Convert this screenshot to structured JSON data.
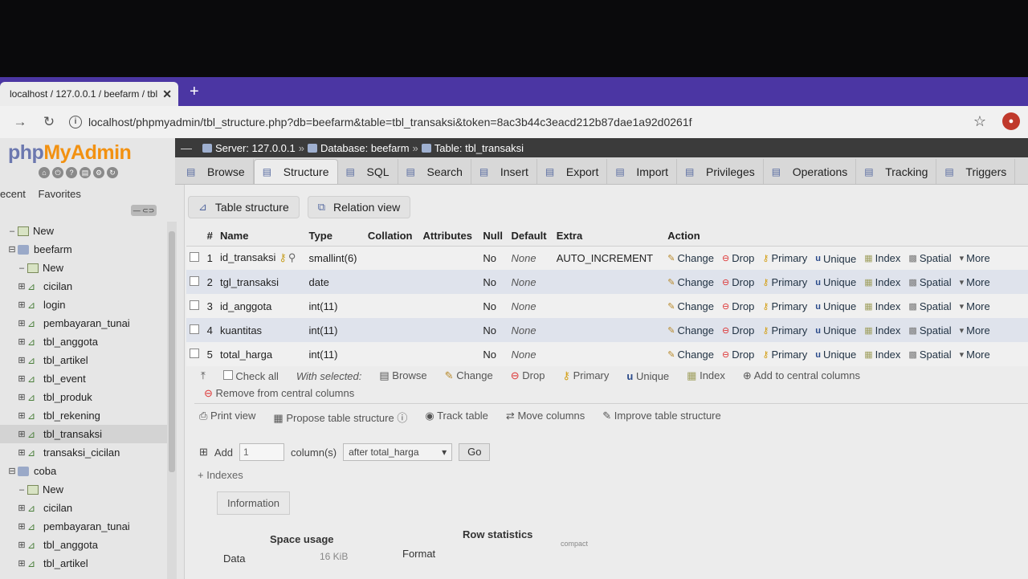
{
  "browser": {
    "tab_title": "localhost / 127.0.0.1 / beefarm / tbl",
    "url": "localhost/phpmyadmin/tbl_structure.php?db=beefarm&table=tbl_transaksi&token=8ac3b44c3eacd212b87dae1a92d0261f"
  },
  "sidebar": {
    "logo_php": "php",
    "logo_mya": "MyAdmin",
    "recent": "ecent",
    "favorites": "Favorites",
    "tree": [
      {
        "label": "New",
        "kind": "new",
        "depth": 0
      },
      {
        "label": "beefarm",
        "kind": "db",
        "depth": 0
      },
      {
        "label": "New",
        "kind": "new",
        "depth": 1
      },
      {
        "label": "cicilan",
        "kind": "table",
        "depth": 1
      },
      {
        "label": "login",
        "kind": "table",
        "depth": 1
      },
      {
        "label": "pembayaran_tunai",
        "kind": "table",
        "depth": 1
      },
      {
        "label": "tbl_anggota",
        "kind": "table",
        "depth": 1
      },
      {
        "label": "tbl_artikel",
        "kind": "table",
        "depth": 1
      },
      {
        "label": "tbl_event",
        "kind": "table",
        "depth": 1
      },
      {
        "label": "tbl_produk",
        "kind": "table",
        "depth": 1
      },
      {
        "label": "tbl_rekening",
        "kind": "table",
        "depth": 1
      },
      {
        "label": "tbl_transaksi",
        "kind": "table",
        "depth": 1,
        "active": true
      },
      {
        "label": "transaksi_cicilan",
        "kind": "table",
        "depth": 1
      },
      {
        "label": "coba",
        "kind": "db",
        "depth": 0
      },
      {
        "label": "New",
        "kind": "new",
        "depth": 1
      },
      {
        "label": "cicilan",
        "kind": "table",
        "depth": 1
      },
      {
        "label": "pembayaran_tunai",
        "kind": "table",
        "depth": 1
      },
      {
        "label": "tbl_anggota",
        "kind": "table",
        "depth": 1
      },
      {
        "label": "tbl_artikel",
        "kind": "table",
        "depth": 1
      }
    ]
  },
  "breadcrumb": {
    "server": "Server: 127.0.0.1",
    "database": "Database: beefarm",
    "table": "Table: tbl_transaksi"
  },
  "tabs": [
    {
      "label": "Browse",
      "icon": "browse-icon"
    },
    {
      "label": "Structure",
      "icon": "structure-icon",
      "active": true
    },
    {
      "label": "SQL",
      "icon": "sql-icon"
    },
    {
      "label": "Search",
      "icon": "search-icon"
    },
    {
      "label": "Insert",
      "icon": "insert-icon"
    },
    {
      "label": "Export",
      "icon": "export-icon"
    },
    {
      "label": "Import",
      "icon": "import-icon"
    },
    {
      "label": "Privileges",
      "icon": "privileges-icon"
    },
    {
      "label": "Operations",
      "icon": "operations-icon"
    },
    {
      "label": "Tracking",
      "icon": "tracking-icon"
    },
    {
      "label": "Triggers",
      "icon": "triggers-icon"
    }
  ],
  "subnav": {
    "table_structure": "Table structure",
    "relation_view": "Relation view"
  },
  "columns_header": [
    "#",
    "Name",
    "Type",
    "Collation",
    "Attributes",
    "Null",
    "Default",
    "Extra",
    "Action"
  ],
  "rows": [
    {
      "num": "1",
      "name": "id_transaksi",
      "type": "smallint(6)",
      "collation": "",
      "attributes": "",
      "null": "No",
      "default": "None",
      "extra": "AUTO_INCREMENT"
    },
    {
      "num": "2",
      "name": "tgl_transaksi",
      "type": "date",
      "collation": "",
      "attributes": "",
      "null": "No",
      "default": "None",
      "extra": ""
    },
    {
      "num": "3",
      "name": "id_anggota",
      "type": "int(11)",
      "collation": "",
      "attributes": "",
      "null": "No",
      "default": "None",
      "extra": ""
    },
    {
      "num": "4",
      "name": "kuantitas",
      "type": "int(11)",
      "collation": "",
      "attributes": "",
      "null": "No",
      "default": "None",
      "extra": ""
    },
    {
      "num": "5",
      "name": "total_harga",
      "type": "int(11)",
      "collation": "",
      "attributes": "",
      "null": "No",
      "default": "None",
      "extra": ""
    }
  ],
  "actions": {
    "change": "Change",
    "drop": "Drop",
    "primary": "Primary",
    "unique": "Unique",
    "index": "Index",
    "spatial": "Spatial",
    "more": "More"
  },
  "with_selected": {
    "check_all": "Check all",
    "with_selected": "With selected:",
    "browse": "Browse",
    "change": "Change",
    "drop": "Drop",
    "primary": "Primary",
    "unique": "Unique",
    "index": "Index",
    "add_central": "Add to central columns",
    "remove_central": "Remove from central columns"
  },
  "tools": {
    "print_view": "Print view",
    "propose": "Propose table structure",
    "track": "Track table",
    "move": "Move columns",
    "improve": "Improve table structure"
  },
  "add_columns": {
    "add": "Add",
    "count": "1",
    "columns": "column(s)",
    "position": "after total_harga",
    "go": "Go"
  },
  "indexes_label": "+ Indexes",
  "information": "Information",
  "space_usage": "Space usage",
  "row_statistics": "Row statistics",
  "data_label": "Data",
  "data_value": "16 KiB",
  "format_label": "Format",
  "format_value": "compact"
}
